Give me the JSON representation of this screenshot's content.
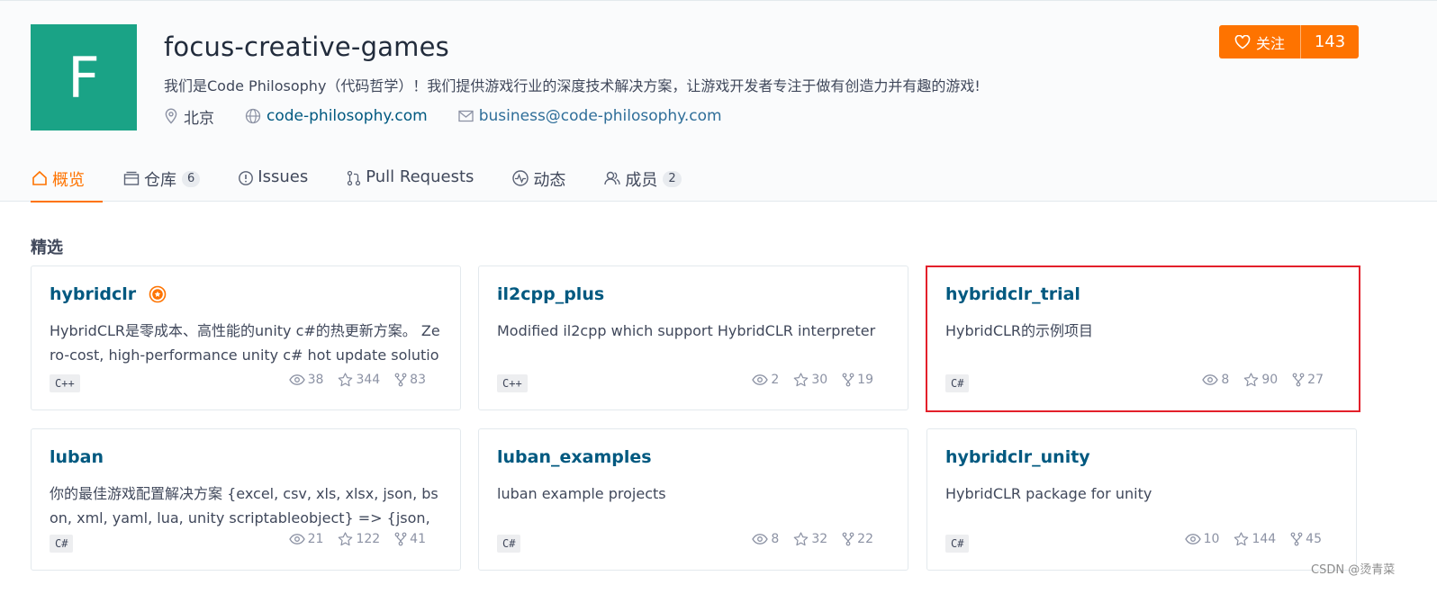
{
  "org": {
    "avatar_letter": "F",
    "name": "focus-creative-games",
    "description": "我们是Code Philosophy（代码哲学）！我们提供游戏行业的深度技术解决方案，让游戏开发者专注于做有创造力并有趣的游戏!",
    "location": "北京",
    "website": "code-philosophy.com",
    "email": "business@code-philosophy.com"
  },
  "follow": {
    "label": "关注",
    "count": "143"
  },
  "tabs": [
    {
      "label": "概览",
      "icon": "home-icon",
      "active": true
    },
    {
      "label": "仓库",
      "icon": "repo-icon",
      "badge": "6"
    },
    {
      "label": "Issues",
      "icon": "issue-icon"
    },
    {
      "label": "Pull Requests",
      "icon": "pull-request-icon"
    },
    {
      "label": "动态",
      "icon": "activity-icon"
    },
    {
      "label": "成员",
      "icon": "members-icon",
      "badge": "2"
    }
  ],
  "section_title": "精选",
  "repos": [
    {
      "name": "hybridclr",
      "recommended": true,
      "description": "HybridCLR是零成本、高性能的unity c#的热更新方案。 Zero-cost, high-performance unity c# hot update solution",
      "language": "C++",
      "watch": "38",
      "star": "344",
      "fork": "83"
    },
    {
      "name": "il2cpp_plus",
      "description": "Modified il2cpp which support HybridCLR interpreter",
      "language": "C++",
      "watch": "2",
      "star": "30",
      "fork": "19"
    },
    {
      "name": "hybridclr_trial",
      "description": "HybridCLR的示例项目",
      "language": "C#",
      "watch": "8",
      "star": "90",
      "fork": "27",
      "highlighted": true
    },
    {
      "name": "luban",
      "description": "你的最佳游戏配置解决方案 {excel, csv, xls, xlsx, json, bson, xml, yaml, lua, unity scriptableobject} => {json, bson, ...",
      "language": "C#",
      "watch": "21",
      "star": "122",
      "fork": "41"
    },
    {
      "name": "luban_examples",
      "description": "luban example projects",
      "language": "C#",
      "watch": "8",
      "star": "32",
      "fork": "22"
    },
    {
      "name": "hybridclr_unity",
      "description": "HybridCLR package for unity",
      "language": "C#",
      "watch": "10",
      "star": "144",
      "fork": "45"
    }
  ],
  "watermark": "CSDN @烫青菜",
  "colors": {
    "accent": "#fe7300",
    "link": "#005980",
    "avatar_bg": "#1aa386",
    "highlight_border": "#e3202a"
  }
}
